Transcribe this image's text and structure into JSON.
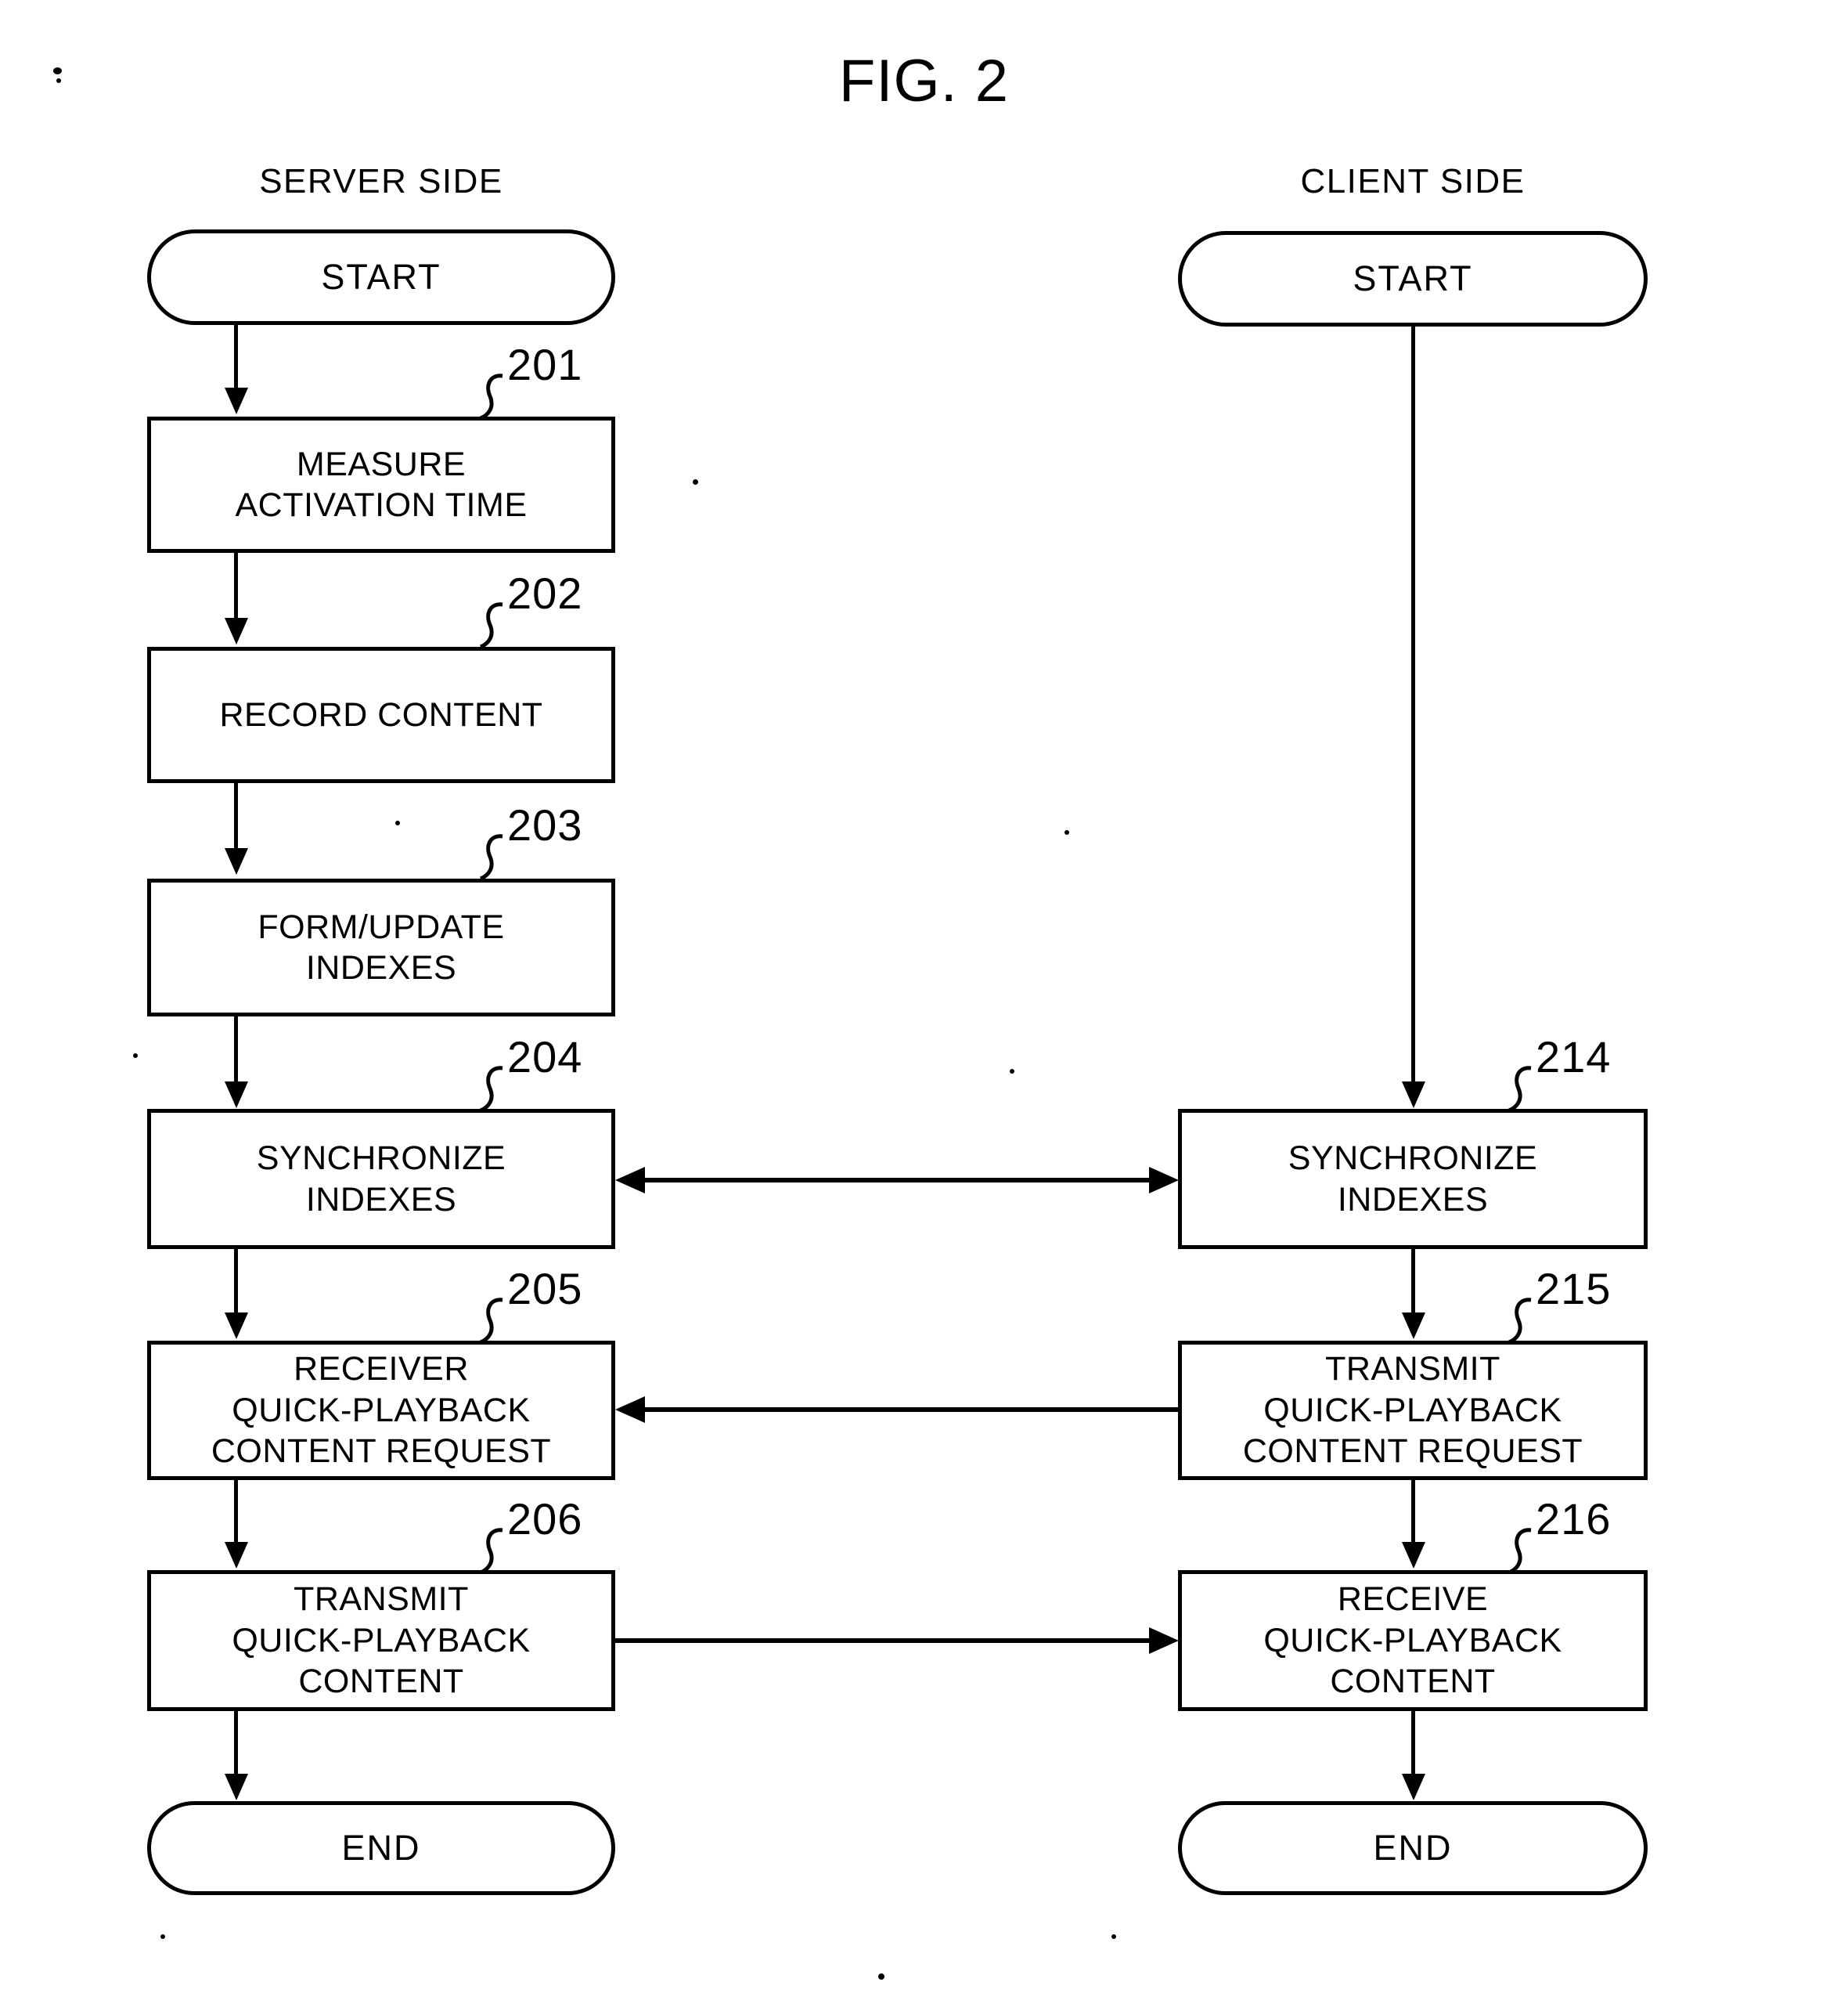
{
  "figure": {
    "title": "FIG. 2"
  },
  "columns": [
    {
      "id": "server",
      "header": "SERVER SIDE"
    },
    {
      "id": "client",
      "header": "CLIENT SIDE"
    }
  ],
  "server_flow": {
    "start": {
      "label": "START"
    },
    "steps": [
      {
        "ref": "201",
        "label": "MEASURE\nACTIVATION TIME"
      },
      {
        "ref": "202",
        "label": "RECORD CONTENT"
      },
      {
        "ref": "203",
        "label": "FORM/UPDATE\nINDEXES"
      },
      {
        "ref": "204",
        "label": "SYNCHRONIZE\nINDEXES"
      },
      {
        "ref": "205",
        "label": "RECEIVER\nQUICK-PLAYBACK\nCONTENT REQUEST"
      },
      {
        "ref": "206",
        "label": "TRANSMIT\nQUICK-PLAYBACK\nCONTENT"
      }
    ],
    "end": {
      "label": "END"
    }
  },
  "client_flow": {
    "start": {
      "label": "START"
    },
    "steps": [
      {
        "ref": "214",
        "label": "SYNCHRONIZE\nINDEXES"
      },
      {
        "ref": "215",
        "label": "TRANSMIT\nQUICK-PLAYBACK\nCONTENT REQUEST"
      },
      {
        "ref": "216",
        "label": "RECEIVE\nQUICK-PLAYBACK\nCONTENT"
      }
    ],
    "end": {
      "label": "END"
    }
  },
  "cross_links": [
    {
      "id": "sync-link",
      "from": "204",
      "to": "214",
      "direction": "bidirectional"
    },
    {
      "id": "request-link",
      "from": "215",
      "to": "205",
      "direction": "left"
    },
    {
      "id": "content-link",
      "from": "206",
      "to": "216",
      "direction": "right"
    }
  ],
  "style": {
    "ink": "#000000",
    "paper": "#ffffff"
  }
}
